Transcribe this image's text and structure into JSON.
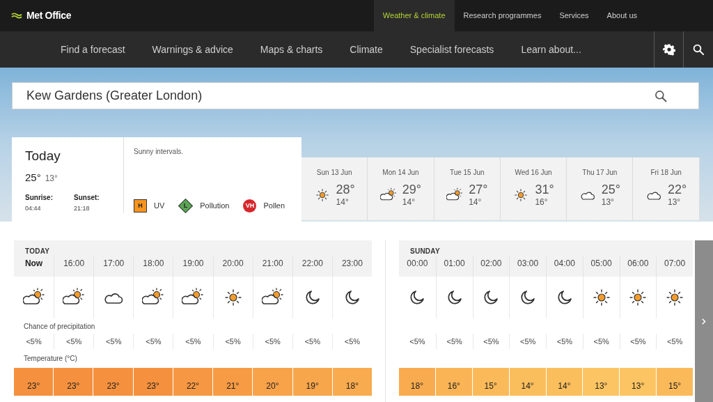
{
  "header": {
    "logo": "Met Office",
    "top_links": [
      {
        "label": "Weather & climate",
        "selected": true
      },
      {
        "label": "Research programmes",
        "selected": false
      },
      {
        "label": "Services",
        "selected": false
      },
      {
        "label": "About us",
        "selected": false
      }
    ],
    "nav": [
      "Find a forecast",
      "Warnings & advice",
      "Maps & charts",
      "Climate",
      "Specialist forecasts",
      "Learn about..."
    ]
  },
  "search": {
    "value": "Kew Gardens (Greater London)"
  },
  "today": {
    "title": "Today",
    "high": "25°",
    "low": "13°",
    "sunrise_label": "Sunrise:",
    "sunrise": "04:44",
    "sunset_label": "Sunset:",
    "sunset": "21:18",
    "summary": "Sunny intervals.",
    "indices": [
      {
        "kind": "uv",
        "badge": "H",
        "label": "UV",
        "color": "#f7941d"
      },
      {
        "kind": "pollution",
        "badge": "L",
        "label": "Pollution",
        "color": "#5ba454"
      },
      {
        "kind": "pollen",
        "badge": "VH",
        "label": "Pollen",
        "color": "#d7262b"
      }
    ]
  },
  "days": [
    {
      "date": "Sun 13 Jun",
      "kind": "sun",
      "high": "28°",
      "low": "14°"
    },
    {
      "date": "Mon 14 Jun",
      "kind": "sun-cloud",
      "high": "29°",
      "low": "14°"
    },
    {
      "date": "Tue 15 Jun",
      "kind": "sun-cloud",
      "high": "27°",
      "low": "14°"
    },
    {
      "date": "Wed 16 Jun",
      "kind": "sun",
      "high": "31°",
      "low": "16°"
    },
    {
      "date": "Thu 17 Jun",
      "kind": "cloud",
      "high": "25°",
      "low": "13°"
    },
    {
      "date": "Fri 18 Jun",
      "kind": "cloud",
      "high": "22°",
      "low": "13°"
    }
  ],
  "hourly": [
    {
      "title": "TODAY",
      "precip_label": "Chance of precipitation",
      "temp_label": "Temperature (°C)",
      "hours": [
        {
          "time": "Now",
          "current": true,
          "kind": "sun-cloud",
          "precip": "<5%",
          "temp": "23°",
          "color": "#f5913e"
        },
        {
          "time": "16:00",
          "current": false,
          "kind": "sun-cloud",
          "precip": "<5%",
          "temp": "23°",
          "color": "#f5913e"
        },
        {
          "time": "17:00",
          "current": false,
          "kind": "cloud",
          "precip": "<5%",
          "temp": "23°",
          "color": "#f5913e"
        },
        {
          "time": "18:00",
          "current": false,
          "kind": "sun-cloud",
          "precip": "<5%",
          "temp": "23°",
          "color": "#f5913e"
        },
        {
          "time": "19:00",
          "current": false,
          "kind": "sun-cloud",
          "precip": "<5%",
          "temp": "22°",
          "color": "#f69843"
        },
        {
          "time": "20:00",
          "current": false,
          "kind": "sun",
          "precip": "<5%",
          "temp": "21°",
          "color": "#f79b45"
        },
        {
          "time": "21:00",
          "current": false,
          "kind": "sun-cloud",
          "precip": "<5%",
          "temp": "20°",
          "color": "#f8a24a"
        },
        {
          "time": "22:00",
          "current": false,
          "kind": "moon",
          "precip": "<5%",
          "temp": "19°",
          "color": "#f8a64c"
        },
        {
          "time": "23:00",
          "current": false,
          "kind": "moon",
          "precip": "<5%",
          "temp": "18°",
          "color": "#f9ab4f"
        }
      ]
    },
    {
      "title": "SUNDAY",
      "hours": [
        {
          "time": "00:00",
          "current": false,
          "kind": "moon",
          "precip": "<5%",
          "temp": "18°",
          "color": "#f9ab4f"
        },
        {
          "time": "01:00",
          "current": false,
          "kind": "moon",
          "precip": "<5%",
          "temp": "16°",
          "color": "#fab456"
        },
        {
          "time": "02:00",
          "current": false,
          "kind": "moon",
          "precip": "<5%",
          "temp": "15°",
          "color": "#fbba5a"
        },
        {
          "time": "03:00",
          "current": false,
          "kind": "moon",
          "precip": "<5%",
          "temp": "14°",
          "color": "#fbbe5d"
        },
        {
          "time": "04:00",
          "current": false,
          "kind": "moon",
          "precip": "<5%",
          "temp": "14°",
          "color": "#fbbe5d"
        },
        {
          "time": "05:00",
          "current": false,
          "kind": "sun",
          "precip": "<5%",
          "temp": "13°",
          "color": "#fcc462"
        },
        {
          "time": "06:00",
          "current": false,
          "kind": "sun",
          "precip": "<5%",
          "temp": "13°",
          "color": "#fcc462"
        },
        {
          "time": "07:00",
          "current": false,
          "kind": "sun",
          "precip": "<5%",
          "temp": "15°",
          "color": "#fbba5a"
        }
      ]
    }
  ]
}
